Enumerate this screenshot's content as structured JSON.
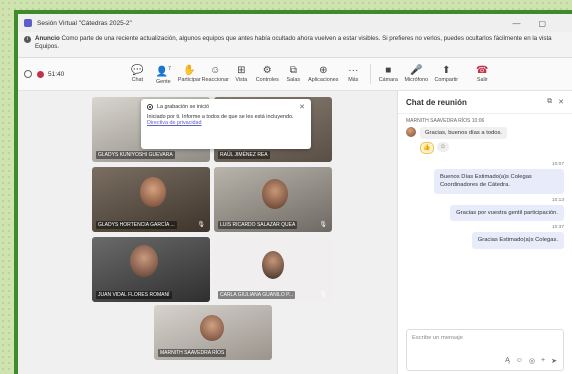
{
  "window": {
    "title": "Sesión Virtual \"Cátedras 2025-2\"",
    "controls": [
      "—",
      "▢"
    ]
  },
  "banner": {
    "label": "Anuncio",
    "text": "Como parte de una reciente actualización, algunos equipos que antes había ocultado ahora vuelven a estar visibles. Si prefieres no verlos, puedes ocultarlos fácilmente en la vista Equipos."
  },
  "toolbar": {
    "timer": "51:40",
    "participants_count": "7",
    "items": [
      {
        "label": "Chat",
        "icon": "chat-icon",
        "glyph": "💬"
      },
      {
        "label": "Gente",
        "icon": "people-icon",
        "glyph": "👤"
      },
      {
        "label": "Participar",
        "icon": "raise-hand-icon",
        "glyph": "✋"
      },
      {
        "label": "Reaccionar",
        "icon": "smile-icon",
        "glyph": "☺"
      },
      {
        "label": "Vista",
        "icon": "grid-view-icon",
        "glyph": "⊞"
      },
      {
        "label": "Controles",
        "icon": "controls-icon",
        "glyph": "⚙"
      },
      {
        "label": "Salas",
        "icon": "rooms-icon",
        "glyph": "⧉"
      },
      {
        "label": "Aplicaciones",
        "icon": "apps-icon",
        "glyph": "⊕"
      },
      {
        "label": "Más",
        "icon": "more-icon",
        "glyph": "···"
      }
    ],
    "devices": [
      {
        "label": "Cámara",
        "icon": "camera-icon",
        "glyph": "■"
      },
      {
        "label": "Micrófono",
        "icon": "microphone-icon",
        "glyph": "🎤"
      },
      {
        "label": "Compartir",
        "icon": "share-icon",
        "glyph": "⬆"
      }
    ],
    "leave": {
      "label": "Salir",
      "icon": "hang-up-icon",
      "glyph": "☎"
    }
  },
  "toast": {
    "title": "La grabación se inició",
    "text": "Iniciado por ti. Informe a todos de que se les está incluyendo.",
    "link": "Directiva de privacidad"
  },
  "participants": [
    {
      "name": "GLADYS KUNIYOSHI GUEVARA"
    },
    {
      "name": "RAÚL JIMÉNEZ REA"
    },
    {
      "name": "GLADYS HORTENCIA GARCÍA ..."
    },
    {
      "name": "LUIS RICARDO SALAZAR QUEA"
    },
    {
      "name": "JUAN VIDAL FLORES ROMANÍ"
    },
    {
      "name": "CARLA GIULIANA GUANILO P..."
    },
    {
      "name": "MARNITH SAAVEDRA RÍOS"
    }
  ],
  "chat": {
    "title": "Chat de reunión",
    "incoming": {
      "sender": "MARNITH SAAVEDRA RÍOS 10:06",
      "text": "Gracias, buenos días a todos."
    },
    "outgoing": [
      {
        "time": "10:07",
        "text": "Buenos Días Estimado(a)s Colegas Coordinadores de Cátedra."
      },
      {
        "time": "10:13",
        "text": "Gracias por vuestra gentil participación."
      },
      {
        "time": "10:37",
        "text": "Gracias Estimado(a)s Colegas."
      }
    ],
    "composer_placeholder": "Escribe un mensaje"
  }
}
